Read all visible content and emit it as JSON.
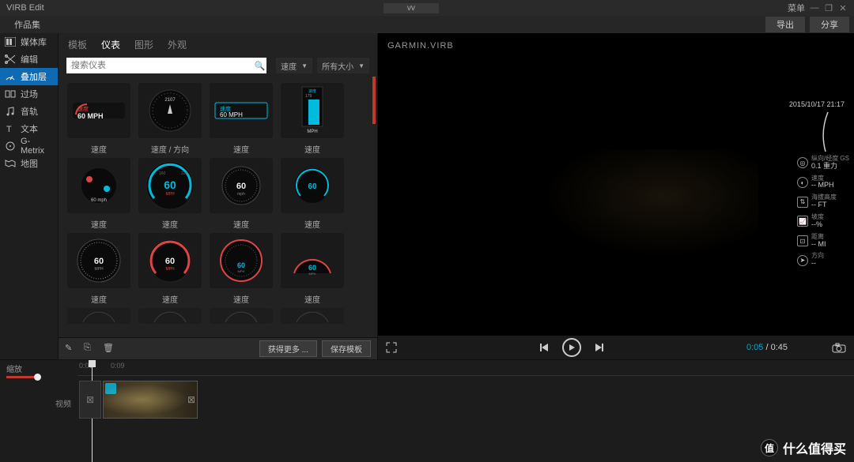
{
  "app": {
    "title": "VIRB Edit",
    "document": "vv",
    "menu": "菜单"
  },
  "secondbar": {
    "worksets": "作品集",
    "export": "导出",
    "share": "分享"
  },
  "sidebar": {
    "items": [
      {
        "label": "媒体库",
        "icon": "media"
      },
      {
        "label": "编辑",
        "icon": "cut"
      },
      {
        "label": "叠加层",
        "icon": "gauge",
        "active": true
      },
      {
        "label": "过场",
        "icon": "transition"
      },
      {
        "label": "音轨",
        "icon": "music"
      },
      {
        "label": "文本",
        "icon": "text"
      },
      {
        "label": "G-Metrix",
        "icon": "gmetrix"
      },
      {
        "label": "地图",
        "icon": "map"
      }
    ]
  },
  "tabs": [
    {
      "label": "模板"
    },
    {
      "label": "仪表",
      "active": true
    },
    {
      "label": "图形"
    },
    {
      "label": "外观"
    }
  ],
  "search": {
    "placeholder": "搜索仪表"
  },
  "filters": {
    "speed": "速度",
    "size": "所有大小"
  },
  "gauges": {
    "row1": [
      {
        "label": "速度",
        "text": "60 MPH",
        "heading": "速度",
        "style": "digital-red"
      },
      {
        "label": "速度 / 方向",
        "style": "compass"
      },
      {
        "label": "速度",
        "text": "60 MPH",
        "heading": "速度",
        "style": "digital-blue"
      },
      {
        "label": "速度",
        "heading": "速度",
        "style": "bar-blue"
      }
    ],
    "row2": [
      {
        "label": "速度",
        "text": "60 mph",
        "style": "dot-blue"
      },
      {
        "label": "速度",
        "text": "60",
        "style": "dial-blue-lg"
      },
      {
        "label": "速度",
        "text": "60",
        "style": "dial-white"
      },
      {
        "label": "速度",
        "text": "60",
        "style": "dial-blue-sm"
      }
    ],
    "row3": [
      {
        "label": "速度",
        "text": "60",
        "style": "dial-bw"
      },
      {
        "label": "速度",
        "text": "60",
        "style": "dial-red"
      },
      {
        "label": "速度",
        "text": "60",
        "style": "dial-red-blue"
      },
      {
        "label": "速度",
        "text": "60",
        "style": "dial-red-half"
      }
    ]
  },
  "toolbar": {
    "more": "获得更多 ...",
    "save": "保存模板"
  },
  "preview": {
    "brand": "GARMIN.VIRB",
    "timestamp": "2015/10/17 21:17",
    "stats": [
      {
        "label": "纵向/经度 GS",
        "value": "0.1 重力",
        "icon": "gmeter"
      },
      {
        "label": "速度",
        "value": "-- MPH",
        "icon": "speedo"
      },
      {
        "label": "海拔高度",
        "value": "-- FT",
        "icon": "alt"
      },
      {
        "label": "坡度",
        "value": "--%",
        "icon": "grade"
      },
      {
        "label": "距离",
        "value": "-- MI",
        "icon": "dist"
      },
      {
        "label": "方向",
        "value": "--",
        "icon": "heading"
      }
    ],
    "time": {
      "current": "0:05",
      "total": "0:45",
      "sep": "/"
    }
  },
  "timeline": {
    "zoom": "缩放",
    "lanes": {
      "video": "视频"
    },
    "ticks": [
      {
        "t": "0:00",
        "x": 2
      },
      {
        "t": "0:09",
        "x": 42
      }
    ]
  },
  "watermark": "什么值得买"
}
